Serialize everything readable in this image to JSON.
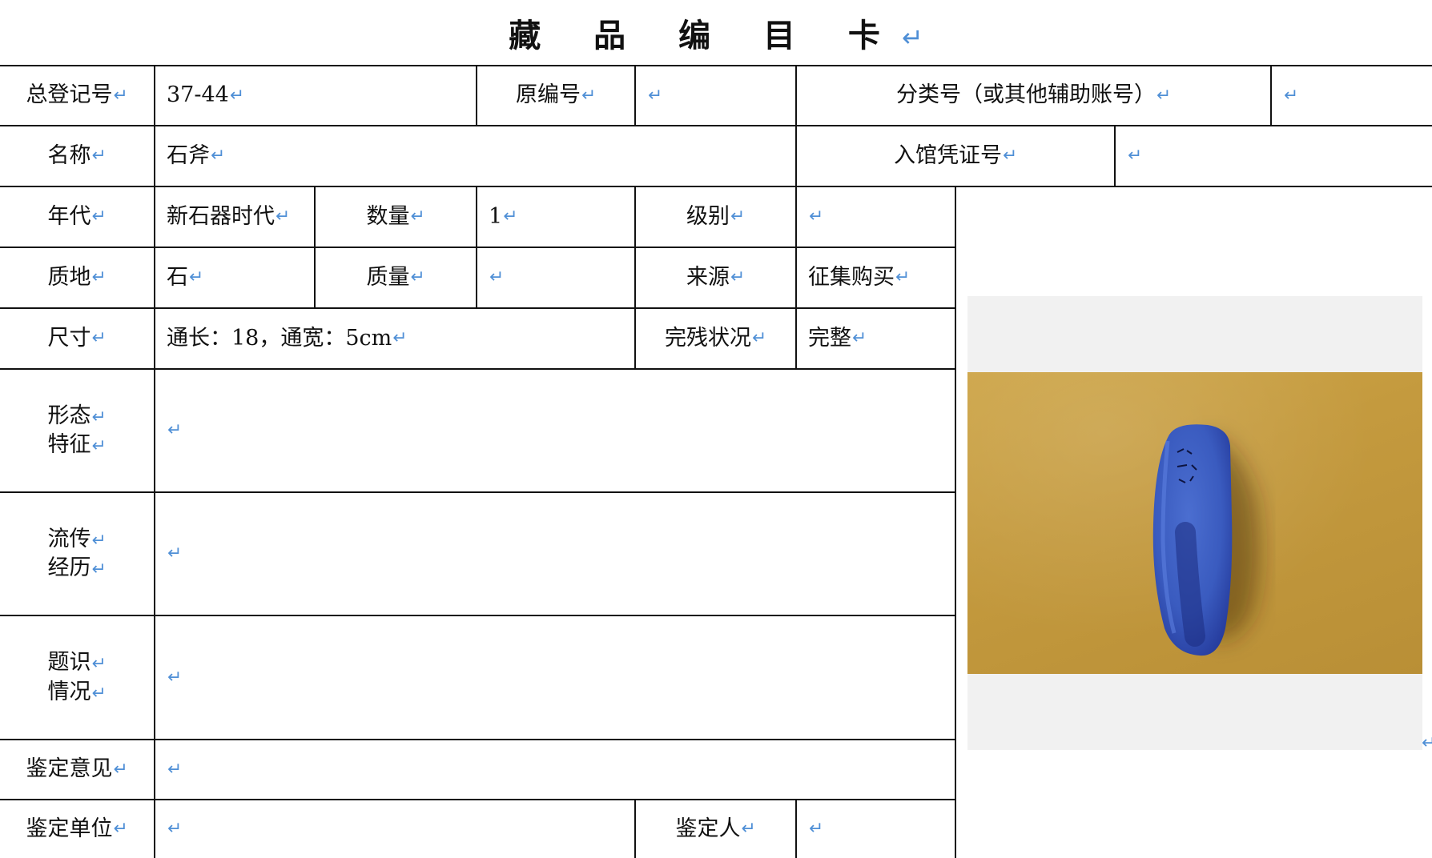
{
  "title": "藏 品 编 目 卡",
  "row1": {
    "total_reg_label": "总登记号",
    "total_reg_value": "37-44",
    "orig_no_label": "原编号",
    "orig_no_value": "",
    "class_no_label": "分类号（或其他辅助账号）",
    "class_no_value": ""
  },
  "row2": {
    "name_label": "名称",
    "name_value": "石斧",
    "voucher_label": "入馆凭证号",
    "voucher_value": ""
  },
  "row3": {
    "era_label": "年代",
    "era_value": "新石器时代",
    "qty_label": "数量",
    "qty_value": "1",
    "grade_label": "级别",
    "grade_value": ""
  },
  "row4": {
    "material_label": "质地",
    "material_value": "石",
    "weight_label": "质量",
    "weight_value": "",
    "source_label": "来源",
    "source_value": "征集购买"
  },
  "row5": {
    "size_label": "尺寸",
    "size_value": "通长：18，通宽：5cm",
    "condition_label": "完残状况",
    "condition_value": "完整"
  },
  "form": {
    "line1": "形态",
    "line2": "特征",
    "value": ""
  },
  "history": {
    "line1": "流传",
    "line2": "经历",
    "value": ""
  },
  "inscription": {
    "line1": "题识",
    "line2": "情况",
    "value": ""
  },
  "appraisal_opinion": {
    "label": "鉴定意见",
    "value": ""
  },
  "appraisal_unit": {
    "label": "鉴定单位",
    "value": "",
    "person_label": "鉴定人",
    "person_value": ""
  }
}
